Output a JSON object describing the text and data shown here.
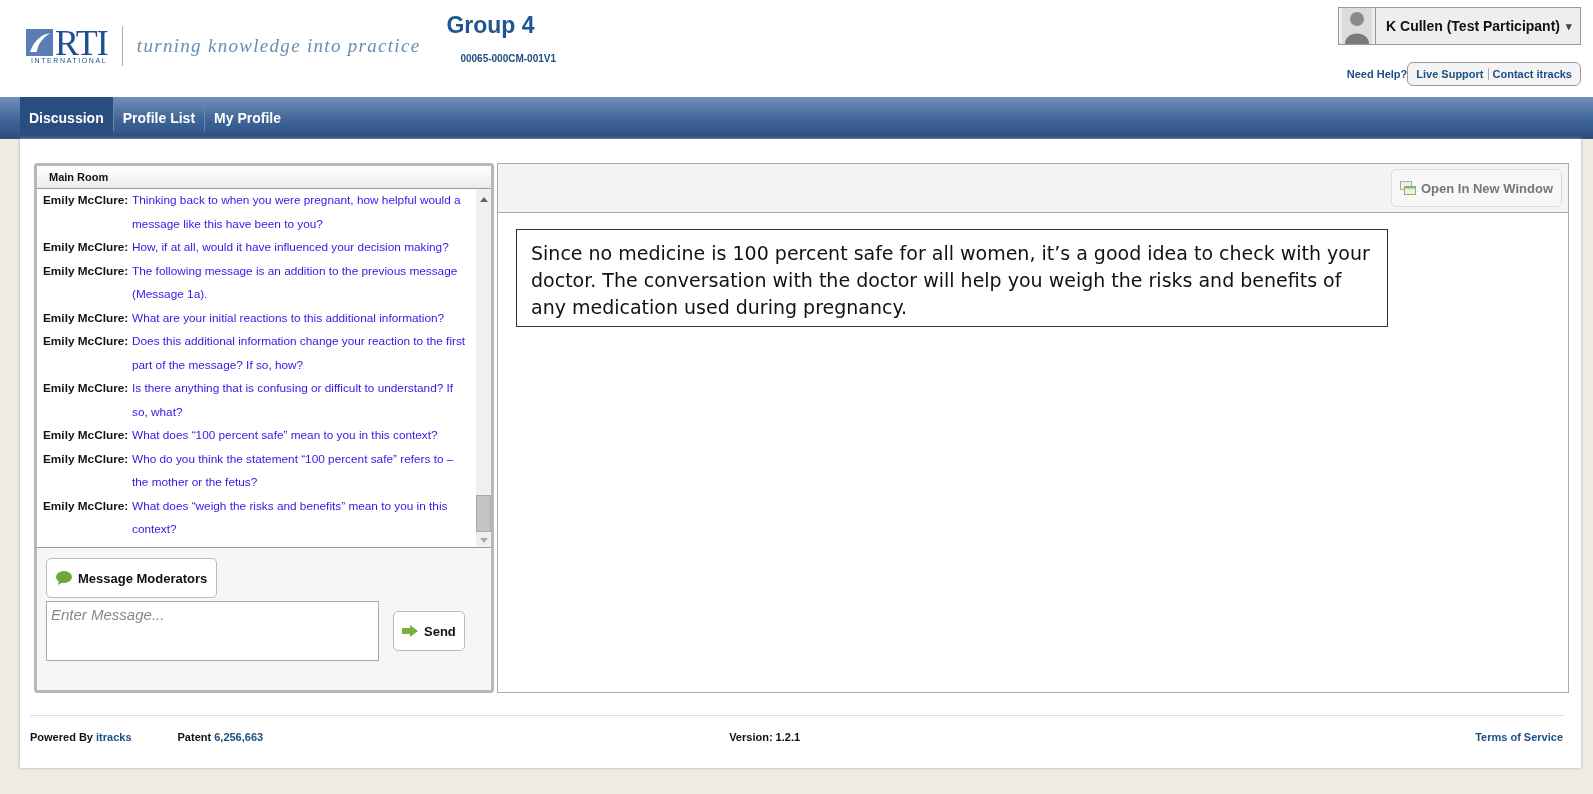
{
  "logo": {
    "mark": "RTI",
    "sub": "INTERNATIONAL",
    "tagline": "turning knowledge into practice"
  },
  "group": {
    "title": "Group 4",
    "code": "00065-000CM-001V1"
  },
  "user": {
    "name": "K Cullen (Test Participant)",
    "caret": "▾"
  },
  "help": {
    "label": "Need Help?",
    "links": [
      "Live Support",
      "Contact itracks"
    ]
  },
  "tabs": [
    {
      "label": "Discussion",
      "selected": true
    },
    {
      "label": "Profile List",
      "selected": false
    },
    {
      "label": "My Profile",
      "selected": false
    }
  ],
  "chat": {
    "room": "Main Room",
    "messages": [
      {
        "author": "Emily McClure:",
        "text": "Thinking back to when you were pregnant, how helpful would a message like this have been to you?"
      },
      {
        "author": "Emily McClure:",
        "text": "How, if at all, would it have influenced your decision making?"
      },
      {
        "author": "Emily McClure:",
        "text": "The following message is an addition to the previous message (Message 1a)."
      },
      {
        "author": "Emily McClure:",
        "text": "What are your initial reactions to this additional information?"
      },
      {
        "author": "Emily McClure:",
        "text": "Does this additional information change your reaction to the first part of the message? If so, how?"
      },
      {
        "author": "Emily McClure:",
        "text": "Is there anything that is confusing or difficult to understand? If so, what?"
      },
      {
        "author": "Emily McClure:",
        "text": "What does “100 percent safe” mean to you in this context?"
      },
      {
        "author": "Emily McClure:",
        "text": "Who do you think the statement “100 percent safe” refers to – the mother or the fetus?"
      },
      {
        "author": "Emily McClure:",
        "text": "What does “weigh the risks and benefits” mean to you in this context?"
      }
    ],
    "moderators_button": "Message Moderators",
    "input": {
      "placeholder": "Enter Message..."
    },
    "send_button": "Send"
  },
  "stimulus": {
    "open_button": {
      "label": "Open In New Window",
      "disabled": true
    },
    "text": "Since no medicine is 100 percent safe for all women, it’s a good idea to check with your doctor. The conversation with the doctor will help you weigh the risks and benefits of any medication used during pregnancy."
  },
  "footer": {
    "powered_label": "Powered By",
    "powered_link": "itracks",
    "patent_label": "Patent",
    "patent_link": "6,256,663",
    "version": "Version: 1.2.1",
    "terms": "Terms of Service"
  }
}
